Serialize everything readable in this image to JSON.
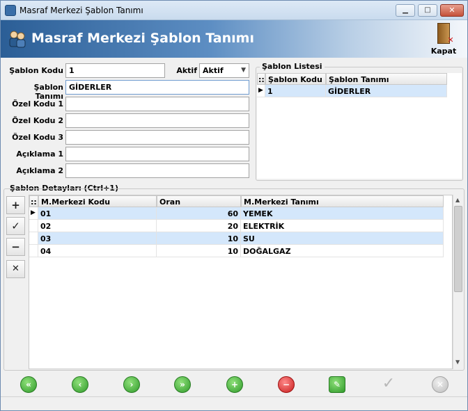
{
  "window": {
    "title": "Masraf Merkezi Şablon Tanımı",
    "min": "▁",
    "max": "□",
    "close": "✕"
  },
  "header": {
    "title": "Masraf Merkezi Şablon Tanımı",
    "close_label": "Kapat"
  },
  "form": {
    "sablon_kodu_label": "Şablon Kodu",
    "sablon_kodu": "1",
    "aktif_label": "Aktif",
    "aktif_value": "Aktif",
    "sablon_tanimi_label": "Şablon Tanımı",
    "sablon_tanimi": "GİDERLER",
    "ozel_kodu_1_label": "Özel Kodu 1",
    "ozel_kodu_1": "",
    "ozel_kodu_2_label": "Özel Kodu 2",
    "ozel_kodu_2": "",
    "ozel_kodu_3_label": "Özel Kodu 3",
    "ozel_kodu_3": "",
    "aciklama_1_label": "Açıklama 1",
    "aciklama_1": "",
    "aciklama_2_label": "Açıklama 2",
    "aciklama_2": ""
  },
  "sablon_listesi": {
    "title": "Şablon Listesi",
    "columns": [
      "::",
      "Şablon Kodu",
      "Şablon Tanımı"
    ],
    "rows": [
      {
        "kod": "1",
        "tanim": "GİDERLER"
      }
    ]
  },
  "detaylar": {
    "title": "Şablon Detayları (Ctrl+1)",
    "columns": [
      "::",
      "M.Merkezi Kodu",
      "Oran",
      "M.Merkezi Tanımı"
    ],
    "rows": [
      {
        "kod": "01",
        "oran": "60",
        "tanim": "YEMEK"
      },
      {
        "kod": "02",
        "oran": "20",
        "tanim": "ELEKTRİK"
      },
      {
        "kod": "03",
        "oran": "10",
        "tanim": "SU"
      },
      {
        "kod": "04",
        "oran": "10",
        "tanim": "DOĞALGAZ"
      }
    ]
  },
  "side_buttons": {
    "add": "+",
    "confirm": "✓",
    "remove": "−",
    "cancel": "✕"
  },
  "nav": {
    "first": "«",
    "prev": "‹",
    "next": "›",
    "last": "»",
    "add": "+",
    "delete": "−",
    "edit": "✎",
    "save": "✓",
    "cancel": "✕"
  },
  "colors": {
    "header_start": "#2b5e96",
    "selected_row": "#d4e7fb",
    "accent": "#6f9bcf"
  }
}
